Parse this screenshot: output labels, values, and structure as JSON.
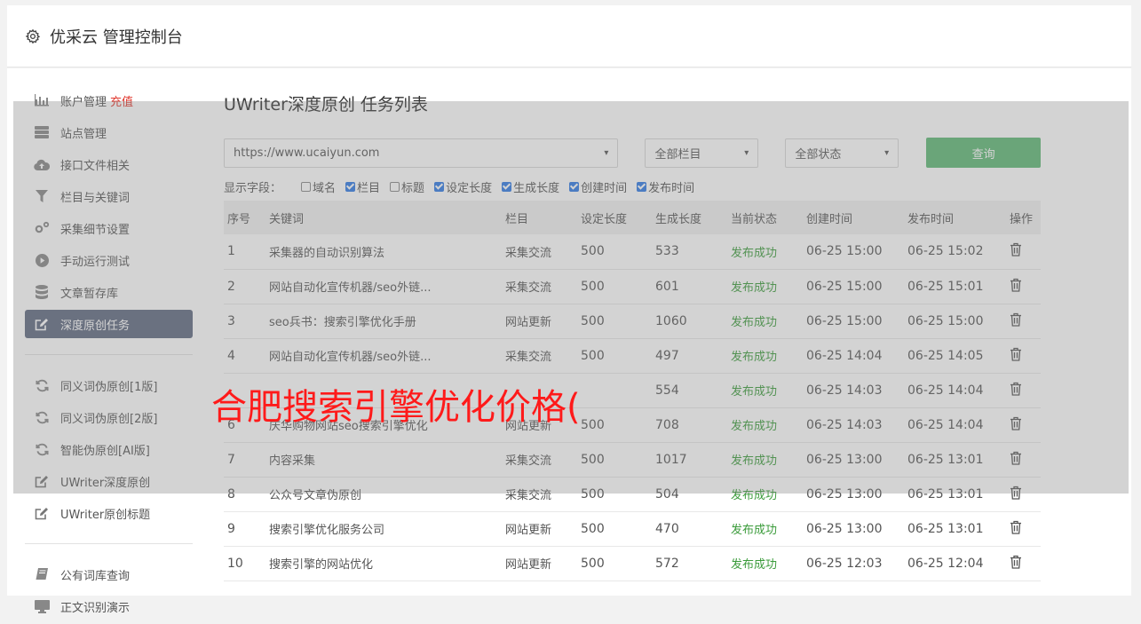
{
  "app": {
    "title": "优采云 管理控制台",
    "icon": "gear-icon"
  },
  "sidebar": {
    "groups": [
      [
        {
          "label": "账户管理",
          "extra": "充值",
          "icon": "bar-chart-icon"
        },
        {
          "label": "站点管理",
          "icon": "server-icon"
        },
        {
          "label": "接口文件相关",
          "icon": "cloud-upload-icon"
        },
        {
          "label": "栏目与关键词",
          "icon": "filter-icon"
        },
        {
          "label": "采集细节设置",
          "icon": "cogs-icon"
        },
        {
          "label": "手动运行测试",
          "icon": "play-circle-icon"
        },
        {
          "label": "文章暂存库",
          "icon": "database-icon"
        },
        {
          "label": "深度原创任务",
          "icon": "edit-icon",
          "active": true
        }
      ],
      [
        {
          "label": "同义词伪原创[1版]",
          "icon": "refresh-icon"
        },
        {
          "label": "同义词伪原创[2版]",
          "icon": "refresh-icon"
        },
        {
          "label": "智能伪原创[AI版]",
          "icon": "refresh-icon"
        },
        {
          "label": "UWriter深度原创",
          "icon": "edit-icon"
        },
        {
          "label": "UWriter原创标题",
          "icon": "edit-icon"
        }
      ],
      [
        {
          "label": "公有词库查询",
          "icon": "book-icon"
        },
        {
          "label": "正文识别演示",
          "icon": "monitor-icon"
        }
      ]
    ]
  },
  "main": {
    "page_title": "UWriter深度原创 任务列表",
    "filters": {
      "site": "https://www.ucaiyun.com",
      "category": "全部栏目",
      "status": "全部状态",
      "query_label": "查询"
    },
    "fields_label": "显示字段：",
    "fields": [
      {
        "label": "域名",
        "checked": false
      },
      {
        "label": "栏目",
        "checked": true
      },
      {
        "label": "标题",
        "checked": false
      },
      {
        "label": "设定长度",
        "checked": true
      },
      {
        "label": "生成长度",
        "checked": true
      },
      {
        "label": "创建时间",
        "checked": true
      },
      {
        "label": "发布时间",
        "checked": true
      }
    ],
    "table": {
      "columns": [
        "序号",
        "关键词",
        "栏目",
        "设定长度",
        "生成长度",
        "当前状态",
        "创建时间",
        "发布时间",
        "操作"
      ],
      "rows": [
        [
          "1",
          "采集器的自动识别算法",
          "采集交流",
          "500",
          "533",
          "发布成功",
          "06-25 15:00",
          "06-25 15:02"
        ],
        [
          "2",
          "网站自动化宣传机器/seo外链...",
          "采集交流",
          "500",
          "601",
          "发布成功",
          "06-25 15:00",
          "06-25 15:01"
        ],
        [
          "3",
          "seo兵书：搜索引擎优化手册",
          "网站更新",
          "500",
          "1060",
          "发布成功",
          "06-25 15:00",
          "06-25 15:00"
        ],
        [
          "4",
          "网站自动化宣传机器/seo外链...",
          "采集交流",
          "500",
          "497",
          "发布成功",
          "06-25 14:04",
          "06-25 14:05"
        ],
        [
          "",
          "",
          "",
          "",
          "554",
          "发布成功",
          "06-25 14:03",
          "06-25 14:04"
        ],
        [
          "6",
          "庆华购物网站seo搜索引擎优化",
          "网站更新",
          "500",
          "708",
          "发布成功",
          "06-25 14:03",
          "06-25 14:04"
        ],
        [
          "7",
          "内容采集",
          "采集交流",
          "500",
          "1017",
          "发布成功",
          "06-25 13:00",
          "06-25 13:01"
        ],
        [
          "8",
          "公众号文章伪原创",
          "采集交流",
          "500",
          "504",
          "发布成功",
          "06-25 13:00",
          "06-25 13:01"
        ],
        [
          "9",
          "搜索引擎优化服务公司",
          "网站更新",
          "500",
          "470",
          "发布成功",
          "06-25 13:00",
          "06-25 13:01"
        ],
        [
          "10",
          "搜索引擎的网站优化",
          "网站更新",
          "500",
          "572",
          "发布成功",
          "06-25 12:03",
          "06-25 12:04"
        ]
      ],
      "action_icon": "trash-icon"
    }
  },
  "watermark": "合肥搜索引擎优化价格(",
  "colors": {
    "active_bg": "#5f6980",
    "query_btn": "#5fb876",
    "success": "#3a9b3a",
    "accent_red": "#e0372d"
  }
}
